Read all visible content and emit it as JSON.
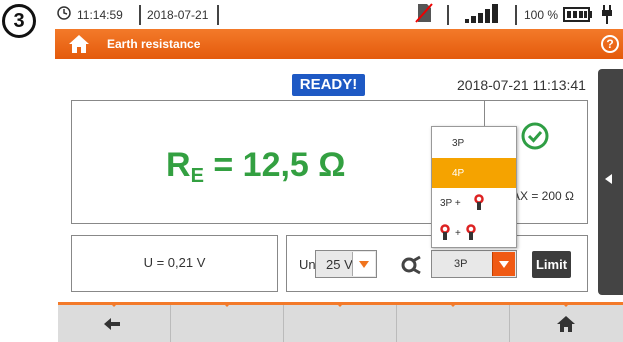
{
  "step_badge": "3",
  "status_bar": {
    "time": "11:14:59",
    "date": "2018-07-21",
    "battery_percent": "100 %",
    "icons": [
      "clock-icon",
      "no-sd-card-icon",
      "signal-strength-icon",
      "battery-icon",
      "plug-icon"
    ]
  },
  "title_bar": {
    "title": "Earth resistance",
    "icons": [
      "home-icon",
      "help-icon"
    ]
  },
  "status": {
    "ready": "READY!",
    "datetime": "2018-07-21 11:13:41"
  },
  "result": {
    "symbol": "R",
    "subscript": "E",
    "value_text": " = 12,5 Ω",
    "limit_text": "AX = 200 Ω",
    "check_icon": "check-circle-icon"
  },
  "measurement": {
    "voltage": "U = 0,21 V"
  },
  "settings": {
    "un_label": "Un",
    "un_value": "25 V",
    "mode_value": "3P",
    "limit_button": "Limit"
  },
  "mode_dropdown": {
    "options": [
      "3P",
      "4P",
      "3P +",
      "+"
    ],
    "selected": "4P"
  },
  "toolbar": {
    "buttons": [
      "back-arrow-icon",
      "",
      "",
      "",
      "home-icon"
    ]
  },
  "colors": {
    "accent_orange": "#f37a2a",
    "ready_blue": "#1e59c4",
    "result_green": "#33a041",
    "selected_option": "#f5a300"
  }
}
